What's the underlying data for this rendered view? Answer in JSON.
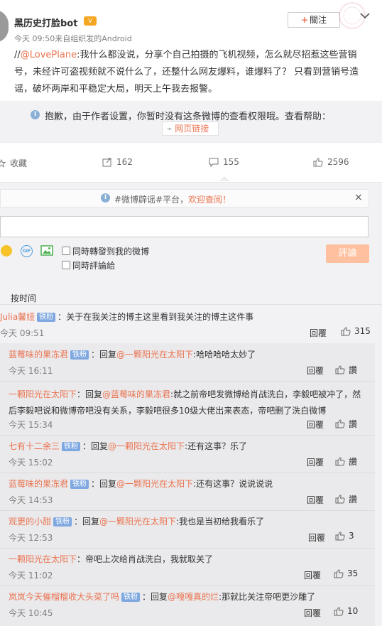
{
  "post": {
    "author": "黑历史打脸bot",
    "meta": "今天 09:50来自组织发的Android",
    "follow_label": "關注",
    "text_mention": "@LovePlane",
    "text_prefix": "//",
    "text_body": ":我什么都没说，分享个自己拍摄的飞机视频，怎么就尽招惹这些营销号，未经许可盗视频就不说什么了，还整什么网友爆料，谁爆料了？ 只看到营销号造谣，破坏两岸和平稳定大局，明天上午我去报警。"
  },
  "notice": {
    "text": "抱歉，由于作者设置，你暂时没有这条微博的查看权限哦。查看帮助：",
    "link_label": "网页链接"
  },
  "actions": {
    "favorite_label": "收藏",
    "forward_count": "162",
    "comment_count": "155",
    "like_count": "2596"
  },
  "comment_box": {
    "rumor_prefix": "#微博辟谣#平台，",
    "rumor_link": "欢迎查阅！",
    "forward_label": "同時轉發到我的微博",
    "comment_label": "同時評論給",
    "submit_label": "評論"
  },
  "sort_label": "按时间",
  "main_comment": {
    "user": "Julia馨娅",
    "badge": "铁粉",
    "text": "：关于在我关注的博主这里看到我关注的博主这件事",
    "time": "今天 09:51",
    "reply_label": "回覆",
    "likes": "315"
  },
  "replies": [
    {
      "user": "蓝莓味的果冻君",
      "badge": "铁粉",
      "mid": "：回复",
      "target": "@一颗阳光在太阳下",
      "text": ":哈哈哈哈太妙了",
      "time": "今天 16:11",
      "reply_label": "回覆",
      "likes": "讚"
    },
    {
      "user": "一颗阳光在太阳下",
      "badge": "",
      "mid": "：回复",
      "target": "@蓝莓味的果冻君",
      "text": ":就之前帝吧发微博给肖战洗白，李毅吧被冲了，然后李毅吧说和微博帝吧没有关系，李毅吧很多10级大佬出来表态，帝吧删了洗白微博",
      "time": "今天 15:34",
      "reply_label": "回覆",
      "likes": "讚"
    },
    {
      "user": "七有十二余三",
      "badge": "铁粉",
      "mid": "：回复",
      "target": "@一颗阳光在太阳下",
      "text": ":还有这事？乐了",
      "time": "今天 15:02",
      "reply_label": "回覆",
      "likes": "讚"
    },
    {
      "user": "蓝莓味的果冻君",
      "badge": "铁粉",
      "mid": "：回复",
      "target": "@一颗阳光在太阳下",
      "text": ":还有这事？说说说说",
      "time": "今天 14:53",
      "reply_label": "回覆",
      "likes": "讚"
    },
    {
      "user": "观更的小甜",
      "badge": "铁粉",
      "mid": "：回复",
      "target": "@一颗阳光在太阳下",
      "text": ":我也是当初给我看乐了",
      "time": "今天 12:53",
      "reply_label": "回覆",
      "likes": "3"
    },
    {
      "user": "一颗阳光在太阳下",
      "badge": "",
      "mid": "：帝吧上次给肖战洗白，我就取关了",
      "target": "",
      "text": "",
      "time": "今天 11:02",
      "reply_label": "回覆",
      "likes": "35"
    },
    {
      "user": "岚岚今天催榴榴收大头菜了吗",
      "badge": "铁粉",
      "mid": "：回复",
      "target": "@嘎嘎真的烂",
      "text": ":那就比关注帝吧更沙雕了",
      "time": "今天 10:45",
      "reply_label": "回覆",
      "likes": "10"
    }
  ]
}
